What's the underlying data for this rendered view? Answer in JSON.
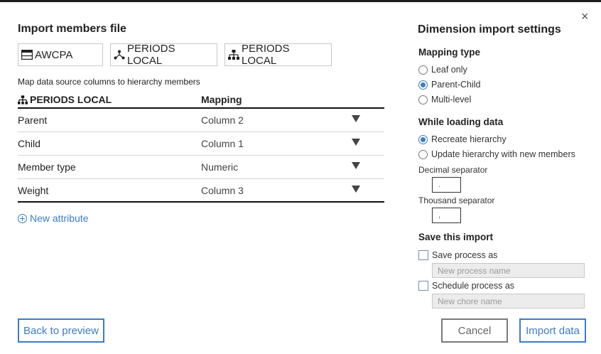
{
  "dialog": {
    "close_label": "×"
  },
  "left": {
    "title": "Import members file",
    "sources": [
      {
        "label": "AWCPA",
        "icon": "table-icon"
      },
      {
        "label": "PERIODS LOCAL",
        "icon": "hierarchy-icon"
      },
      {
        "label": "PERIODS LOCAL",
        "icon": "dimension-icon"
      }
    ],
    "hint": "Map data source columns to hierarchy members",
    "table": {
      "col1": "PERIODS LOCAL",
      "col2": "Mapping",
      "rows": [
        {
          "attribute": "Parent",
          "mapping": "Column 2"
        },
        {
          "attribute": "Child",
          "mapping": "Column 1"
        },
        {
          "attribute": "Member type",
          "mapping": "Numeric"
        },
        {
          "attribute": "Weight",
          "mapping": "Column 3"
        }
      ]
    },
    "new_attribute": "New attribute",
    "back_button": "Back to preview"
  },
  "right": {
    "title": "Dimension import settings",
    "mapping_type": {
      "heading": "Mapping type",
      "options": [
        "Leaf only",
        "Parent-Child",
        "Multi-level"
      ],
      "selected": "Parent-Child"
    },
    "loading": {
      "heading": "While loading data",
      "options": [
        "Recreate hierarchy",
        "Update hierarchy with new members"
      ],
      "selected": "Recreate hierarchy",
      "decimal_label": "Decimal separator",
      "decimal_value": ".",
      "thousand_label": "Thousand separator",
      "thousand_value": ","
    },
    "save": {
      "heading": "Save this import",
      "save_process_label": "Save process as",
      "process_placeholder": "New process name",
      "schedule_label": "Schedule process as",
      "chore_placeholder": "New chore name"
    },
    "cancel_button": "Cancel",
    "import_button": "Import data"
  },
  "colors": {
    "accent": "#3e7cc3",
    "text": "#222222",
    "border": "#c8c8c8"
  }
}
